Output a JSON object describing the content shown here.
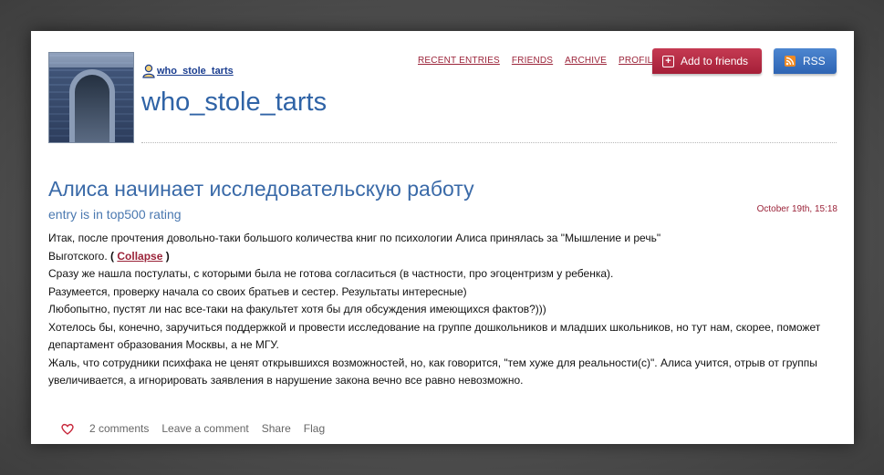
{
  "header": {
    "username": "who_stole_tarts",
    "journal_title": "who_stole_tarts",
    "nav": [
      "RECENT ENTRIES",
      "FRIENDS",
      "ARCHIVE",
      "PROFILE"
    ],
    "add_friends_label": "Add to friends",
    "rss_label": "RSS"
  },
  "entry": {
    "title": "Алиса начинает исследовательскую работу",
    "subtitle": "entry is in top500 rating",
    "date": "October 19th, 15:18",
    "line1": "Итак, после прочтения довольно-таки большого количества книг по психологии Алиса принялась за \"Мышление и речь\"",
    "line2_text": "Выготского.",
    "collapse_open": "(",
    "collapse_label": "Collapse",
    "collapse_close": ")",
    "paragraphs": [
      "Сразу же нашла постулаты, с которыми была не готова согласиться (в частности, про эгоцентризм у ребенка).",
      "Разумеется, проверку начала со своих братьев и сестер. Результаты интересные)",
      "Любопытно, пустят ли нас все-таки на факультет хотя бы для обсуждения имеющихся фактов?)))",
      "Хотелось бы, конечно, заручиться поддержкой и провести исследование на группе дошкольников и младших школьников, но тут нам, скорее, поможет департамент образования Москвы, а не МГУ.",
      "Жаль, что сотрудники психфака не ценят открывшихся возможностей, но, как говорится, \"тем хуже для реальности(с)\". Алиса учится, отрыв от группы увеличивается, а игнорировать заявления в нарушение закона вечно все равно невозможно."
    ]
  },
  "footer": {
    "comments": "2 comments",
    "leave_comment": "Leave a comment",
    "share": "Share",
    "flag": "Flag"
  },
  "colors": {
    "accent_red": "#9b2339",
    "title_blue": "#2f63a6",
    "rss_blue": "#2e64b3",
    "rss_orange": "#f08a24"
  },
  "icons": [
    "user-icon",
    "plus-icon",
    "rss-icon",
    "heart-icon"
  ]
}
